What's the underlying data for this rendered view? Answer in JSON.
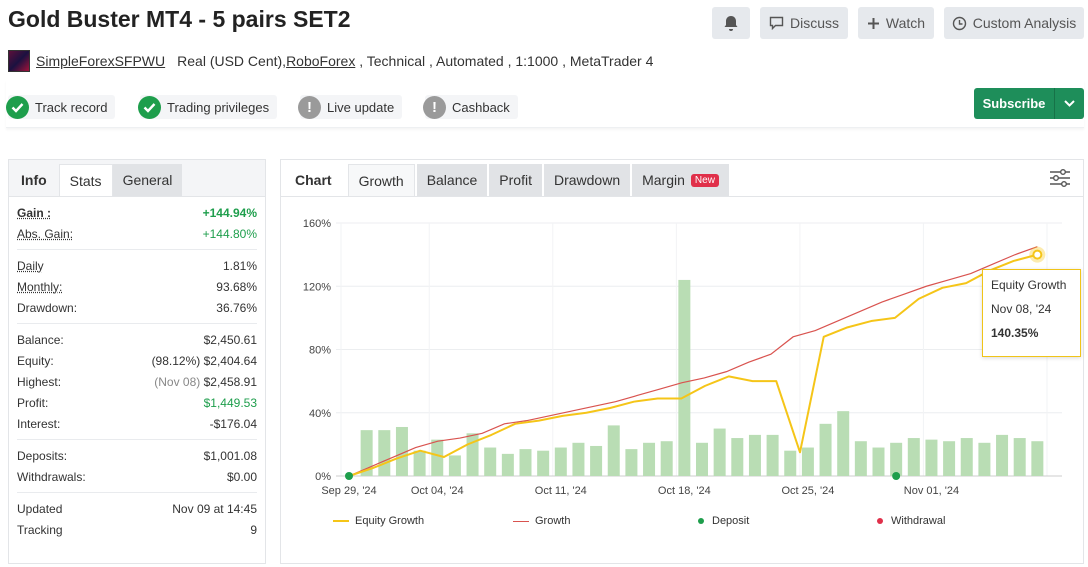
{
  "header": {
    "title": "Gold Buster MT4 - 5 pairs SET2",
    "discuss_label": "Discuss",
    "watch_label": "Watch",
    "custom_analysis_label": "Custom Analysis"
  },
  "meta": {
    "author": "SimpleForexSFPWU",
    "account_type": "Real (USD Cent), ",
    "broker": "RoboForex",
    "details": " , Technical , Automated , 1:1000 , MetaTrader 4"
  },
  "badges": {
    "track_record": "Track record",
    "trading_privileges": "Trading privileges",
    "live_update": "Live update",
    "cashback": "Cashback"
  },
  "subscribe_label": "Subscribe",
  "left_tabs": {
    "info": "Info",
    "stats": "Stats",
    "general": "General"
  },
  "stats": {
    "gain": {
      "label": "Gain :",
      "value": "+144.94%"
    },
    "abs_gain": {
      "label": "Abs. Gain:",
      "value": "+144.80%"
    },
    "daily": {
      "label": "Daily",
      "value": "1.81%"
    },
    "monthly": {
      "label": "Monthly:",
      "value": "93.68%"
    },
    "drawdown": {
      "label": "Drawdown:",
      "value": "36.76%"
    },
    "balance": {
      "label": "Balance:",
      "value": "$2,450.61"
    },
    "equity": {
      "label": "Equity:",
      "prefix": "(98.12%)",
      "value": "$2,404.64"
    },
    "highest": {
      "label": "Highest:",
      "prefix": "(Nov 08)",
      "value": "$2,458.91"
    },
    "profit": {
      "label": "Profit:",
      "value": "$1,449.53"
    },
    "interest": {
      "label": "Interest:",
      "value": "-$176.04"
    },
    "deposits": {
      "label": "Deposits:",
      "value": "$1,001.08"
    },
    "withdrawals": {
      "label": "Withdrawals:",
      "value": "$0.00"
    },
    "updated": {
      "label": "Updated",
      "value": "Nov 09 at 14:45"
    },
    "tracking": {
      "label": "Tracking",
      "value": "9"
    }
  },
  "chart_tabs": {
    "chart": "Chart",
    "growth": "Growth",
    "balance": "Balance",
    "profit": "Profit",
    "drawdown": "Drawdown",
    "margin": "Margin",
    "new_badge": "New"
  },
  "tooltip": {
    "series": "Equity Growth",
    "date": "Nov 08, '24",
    "value": "140.35%"
  },
  "colors": {
    "equity_line": "#f5c518",
    "growth_line": "#d9534f",
    "bars": "#b9ddb4",
    "deposit": "#1e9e4c",
    "withdrawal": "#e0304a",
    "subscribe": "#1e8e5a"
  },
  "chart_data": {
    "type": "bar",
    "ylim": [
      0,
      160
    ],
    "yticks": [
      "0%",
      "40%",
      "80%",
      "120%",
      "160%"
    ],
    "xticks": [
      "Sep 29, '24",
      "Oct 04, '24",
      "Oct 11, '24",
      "Oct 18, '24",
      "Oct 25, '24",
      "Nov 01, '24"
    ],
    "legend": [
      "Equity Growth",
      "Growth",
      "Deposit",
      "Withdrawal"
    ],
    "bars_day_index": [
      1,
      2,
      3,
      4,
      5,
      6,
      7,
      8,
      9,
      10,
      11,
      12,
      13,
      14,
      15,
      16,
      17,
      18,
      19,
      20,
      21,
      22,
      23,
      24,
      25,
      26,
      27,
      28,
      29,
      30,
      31,
      32,
      33,
      34,
      35,
      36,
      37,
      38,
      39,
      40,
      41
    ],
    "bars": [
      29,
      29,
      31,
      16,
      23,
      13,
      27,
      18,
      14,
      17,
      16,
      18,
      21,
      19,
      32,
      17,
      21,
      22,
      124,
      21,
      30,
      24,
      26,
      26,
      16,
      18,
      33,
      41,
      22,
      18,
      21,
      24,
      23,
      22,
      24,
      21,
      26,
      24,
      22,
      27,
      41
    ],
    "growth_x": [
      0,
      1,
      2,
      3,
      4,
      5,
      6,
      7,
      8,
      9,
      10,
      11,
      12,
      13,
      14,
      15,
      16,
      17,
      18,
      19,
      20,
      21,
      22,
      23,
      24,
      25,
      26,
      27,
      28,
      29,
      30,
      31,
      32,
      33,
      34,
      35,
      36,
      37,
      38,
      39,
      40
    ],
    "growth": [
      0,
      6,
      12,
      18,
      22,
      24,
      27,
      33,
      35,
      38,
      41,
      44,
      47,
      51,
      55,
      59,
      62,
      66,
      72,
      77,
      88,
      92,
      98,
      104,
      110,
      115,
      120,
      124,
      128,
      134,
      140,
      145
    ],
    "equity": [
      0,
      5,
      11,
      16,
      12,
      20,
      26,
      33,
      35,
      38,
      40,
      43,
      47,
      49,
      49,
      57,
      63,
      60,
      60,
      15,
      88,
      94,
      98,
      100,
      112,
      119,
      122,
      130,
      136,
      140
    ],
    "deposit_days": [
      0,
      31
    ]
  }
}
